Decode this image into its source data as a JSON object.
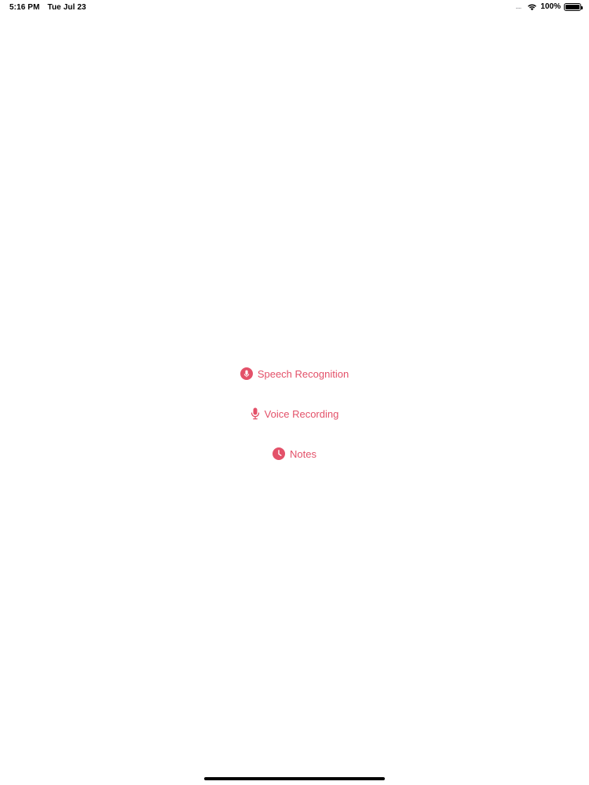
{
  "status_bar": {
    "time": "5:16 PM",
    "date": "Tue Jul 23",
    "dots": "....",
    "battery_percent": "100%",
    "battery_level": 1.0
  },
  "menu": {
    "accent_color": "#e35169",
    "items": [
      {
        "label": "Speech Recognition",
        "icon": "mic-circle-icon"
      },
      {
        "label": "Voice Recording",
        "icon": "mic-icon"
      },
      {
        "label": "Notes",
        "icon": "clock-icon"
      }
    ]
  }
}
